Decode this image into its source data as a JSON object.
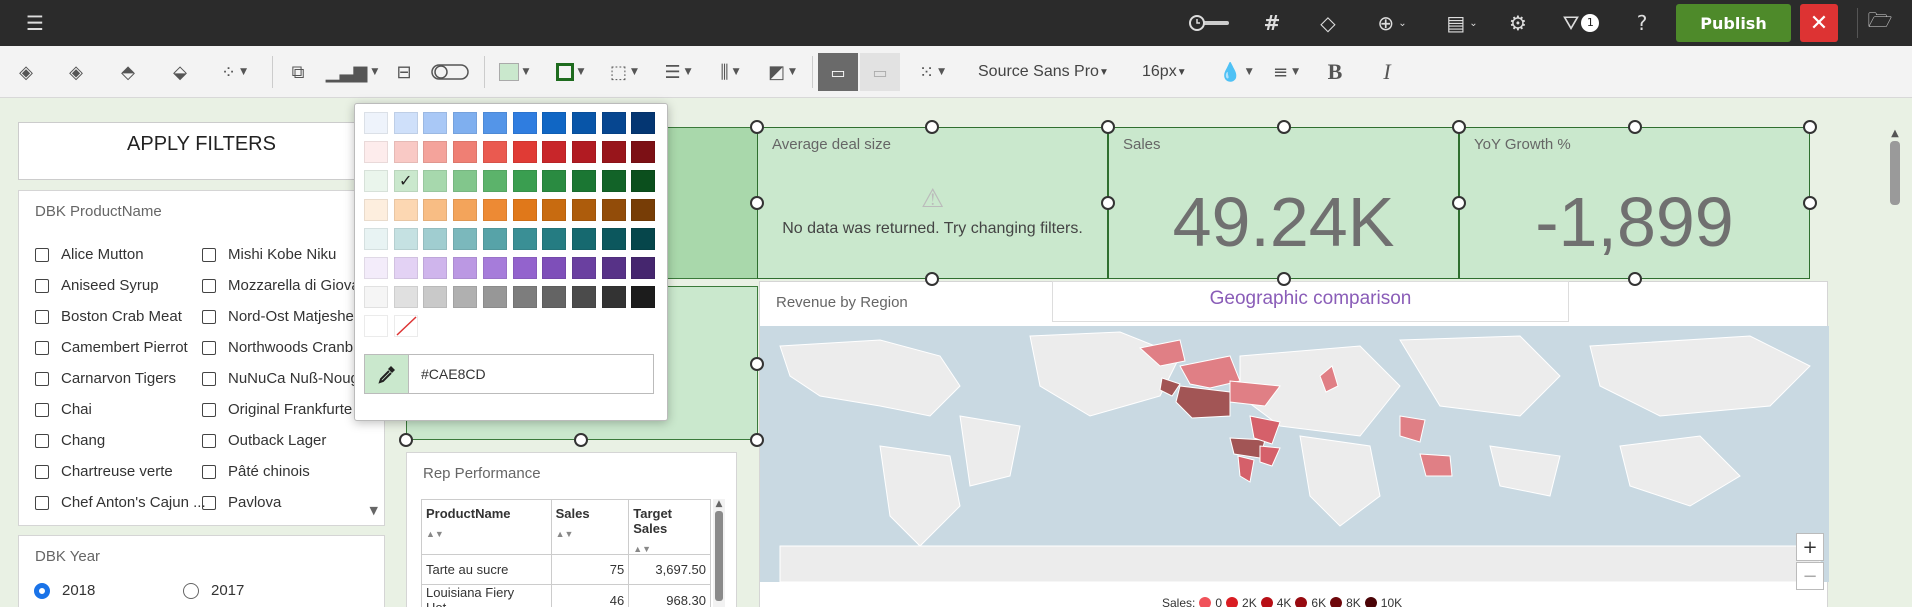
{
  "topbar": {
    "filter_count": "1",
    "publish_label": "Publish"
  },
  "toolbar": {
    "font_family": "Source Sans Pro",
    "font_size": "16px",
    "fill_color": "#CAE8CD",
    "border_color": "#1E6B1E"
  },
  "filters": {
    "apply_label": "APPLY FILTERS",
    "product_title": "DBK ProductName",
    "products_left": [
      "Alice Mutton",
      "Aniseed Syrup",
      "Boston Crab Meat",
      "Camembert Pierrot",
      "Carnarvon Tigers",
      "Chai",
      "Chang",
      "Chartreuse verte",
      "Chef Anton's Cajun ..."
    ],
    "products_right": [
      "Mishi Kobe Niku",
      "Mozzarella di Giova",
      "Nord-Ost Matjeshe",
      "Northwoods Cranb",
      "NuNuCa Nuß-Noug",
      "Original Frankfurte",
      "Outback Lager",
      "Pâté chinois",
      "Pavlova"
    ],
    "year_title": "DBK Year",
    "years": [
      "2018",
      "2017"
    ],
    "selected_year": "2018"
  },
  "kpis": [
    {
      "label": "Average deal size",
      "message": "No data was returned. Try changing filters."
    },
    {
      "label": "Sales",
      "value": "49.24K"
    },
    {
      "label": "YoY Growth %",
      "value": "-1,899"
    }
  ],
  "map": {
    "title": "Revenue by Region",
    "subtitle": "Geographic comparison",
    "legend_label": "Sales:",
    "legend": [
      {
        "label": "0",
        "color": "#f0525a"
      },
      {
        "label": "2K",
        "color": "#d91c22"
      },
      {
        "label": "4K",
        "color": "#b80f16"
      },
      {
        "label": "6K",
        "color": "#970a10"
      },
      {
        "label": "8K",
        "color": "#6e070b"
      },
      {
        "label": "10K",
        "color": "#4a0306"
      }
    ]
  },
  "table": {
    "title": "Rep Performance",
    "columns": [
      "ProductName",
      "Sales",
      "Target Sales"
    ],
    "rows": [
      [
        "Tarte au sucre",
        "75",
        "3,697.50"
      ],
      [
        "Louisiana Fiery Hot...",
        "46",
        "968.30"
      ]
    ]
  },
  "picker": {
    "hex": "#CAE8CD",
    "selected_color": "#CAE8CD",
    "rows": [
      [
        "#eef3fb",
        "#cfe0fa",
        "#a9c8f6",
        "#7fafef",
        "#5495e8",
        "#2f7de0",
        "#1066c4",
        "#0855a8",
        "#064690",
        "#043672"
      ],
      [
        "#fdecec",
        "#f9c9c5",
        "#f4a39b",
        "#ef7f74",
        "#ea5a50",
        "#e03b35",
        "#c8262a",
        "#b11b22",
        "#98151b",
        "#7c1015"
      ],
      [
        "#eaf5ec",
        "#cae8cd",
        "#a7d8ad",
        "#82c68c",
        "#5cb36b",
        "#3a9e50",
        "#2a8b41",
        "#1b7633",
        "#126328",
        "#0b4f1d"
      ],
      [
        "#fdeede",
        "#fcd7b2",
        "#f8bd84",
        "#f3a45b",
        "#ed8a34",
        "#e0781a",
        "#c86b10",
        "#ad5c0c",
        "#924c09",
        "#773d06"
      ],
      [
        "#e8f3f3",
        "#c5e1e2",
        "#a0cdd0",
        "#7bb8bc",
        "#57a3a8",
        "#3a8f95",
        "#257c82",
        "#16696f",
        "#0c575d",
        "#06464b"
      ],
      [
        "#f3ecfa",
        "#e3d2f4",
        "#cfb5ec",
        "#bb98e3",
        "#a67cda",
        "#9363cd",
        "#7e4fb9",
        "#6a40a0",
        "#573287",
        "#45266e"
      ],
      [
        "#f5f5f5",
        "#e0e0e0",
        "#c9c9c9",
        "#b0b0b0",
        "#979797",
        "#7d7d7d",
        "#646464",
        "#4b4b4b",
        "#333333",
        "#1c1c1c"
      ]
    ]
  }
}
